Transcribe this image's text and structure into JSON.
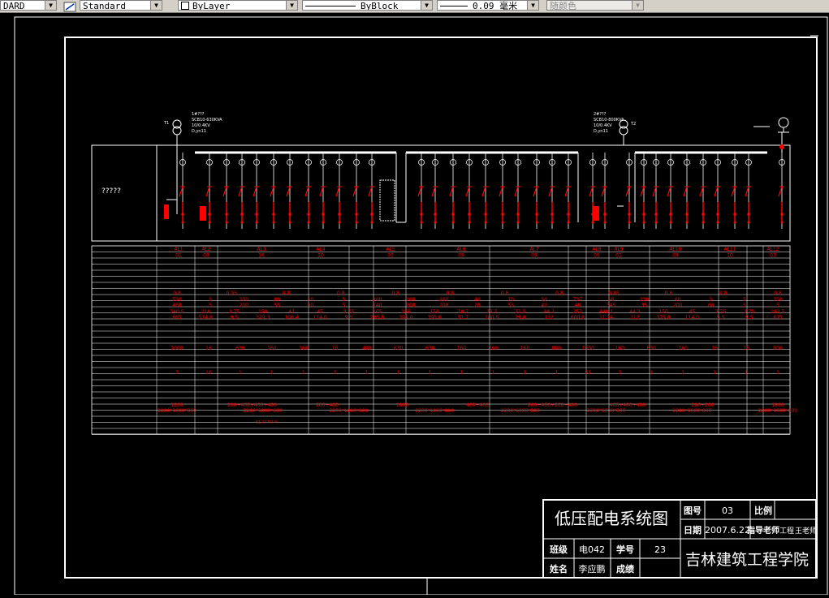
{
  "toolbar": {
    "textstyle": "DARD",
    "dimstyle": "Standard",
    "layer": "ByLayer",
    "linetype": "ByBlock",
    "lineweight": "0.09 毫米",
    "plotstyle": "随颜色"
  },
  "drawing": {
    "placeholder": "?????",
    "transformers": [
      {
        "name": "1#???",
        "spec": "SCB10-630KVA",
        "voltage": "10/0.4KV",
        "group": "D,yn11",
        "tag": "T1"
      },
      {
        "name": "2#???",
        "spec": "SCB10-800KVA",
        "voltage": "10/0.4KV",
        "group": "D,yn11",
        "tag": "T2"
      }
    ],
    "panels": [
      "AL1",
      "AL2",
      "AL3",
      "AL4",
      "AL5",
      "AL6",
      "AL7",
      "AL8",
      "AL9",
      "AL10",
      "AL11",
      "AL12"
    ],
    "panel_types": [
      "01",
      "08",
      "10",
      "10",
      "03",
      "09",
      "09",
      "05",
      "01",
      "09",
      "10",
      "03"
    ],
    "row_values": {
      "rA": [
        "0.8",
        "0.95",
        "0.8",
        "0.8",
        "0.8",
        "0.8",
        "0.8",
        "0.8",
        "0.85",
        "0.8",
        "0.8",
        "0.8"
      ],
      "rB": [
        "550",
        "5",
        "200",
        "80",
        "60",
        "5",
        "200",
        "260",
        "260",
        "40",
        "70",
        "50",
        "737",
        "58",
        "230",
        "60",
        "5",
        "5",
        "350"
      ],
      "rC": [
        "468",
        "5",
        "200",
        "55",
        "60",
        "5",
        "140",
        "208",
        "208",
        "28",
        "53",
        "42",
        "48",
        "345",
        "35",
        "200",
        "60",
        "5",
        "5"
      ],
      "rD": [
        "340.5",
        "218",
        "3.75",
        "150",
        "47",
        "45",
        "3.75",
        "105",
        "156",
        "156",
        "18.7",
        "39.7",
        "31.5",
        "44.2",
        "252",
        "448.1",
        "44.2",
        "150",
        "45",
        "3.75",
        "3.75",
        "262.5"
      ],
      "rE": [
        "865",
        "514.8",
        "9.5",
        "379.3",
        "106.4",
        "114.0",
        "9.5",
        "265.8",
        "395.0",
        "395.0",
        "51.7",
        "100.5",
        "79.8",
        "112",
        "600.8",
        "11.34",
        "112",
        "379.8",
        "114.0",
        "9.5",
        "9.5",
        "675"
      ],
      "rF": [
        "1000",
        "16",
        "630",
        "160",
        "160",
        "16",
        "400",
        "630",
        "630",
        "160",
        "160",
        "160",
        "800",
        "1600",
        "160",
        "630",
        "160",
        "16",
        "16",
        "800"
      ],
      "rG": [
        "3",
        "16",
        "1",
        "1",
        "1",
        "1",
        "1",
        "1",
        "1",
        "1",
        "1",
        "1",
        "1",
        "21",
        "3",
        "1",
        "1",
        "1",
        "1",
        "1"
      ],
      "rH": [
        "1200",
        "200+400+400+400",
        "200+400",
        "1800",
        "400+400",
        "200+400+200+400",
        "400+400+400",
        "200+200",
        "1800"
      ],
      "rI": [
        "2200*1000*800",
        "2200*1000*800",
        "2200*1000*800",
        "2200*1000*800",
        "2200*1000*800",
        "2200*1000*800",
        "2200*1000*800",
        "2200*1000*800"
      ]
    },
    "footer_note": "01-???????"
  },
  "titleblock": {
    "drawing_title": "低压配电系统图",
    "drawing_no_label": "图号",
    "drawing_no": "03",
    "scale_label": "比例",
    "date_label": "日期",
    "date": "2007.6.22",
    "advisor_label": "指导老师",
    "advisor_title": "工程",
    "advisor_name": "王老师",
    "class_label": "班级",
    "class_value": "电042",
    "student_no_label": "学号",
    "student_no": "23",
    "name_label": "姓名",
    "name_value": "李应鹏",
    "grade_label": "成绩",
    "school": "吉林建筑工程学院"
  },
  "colors": {
    "line": "#ffffff",
    "accent": "#ff0000",
    "background": "#000000"
  }
}
